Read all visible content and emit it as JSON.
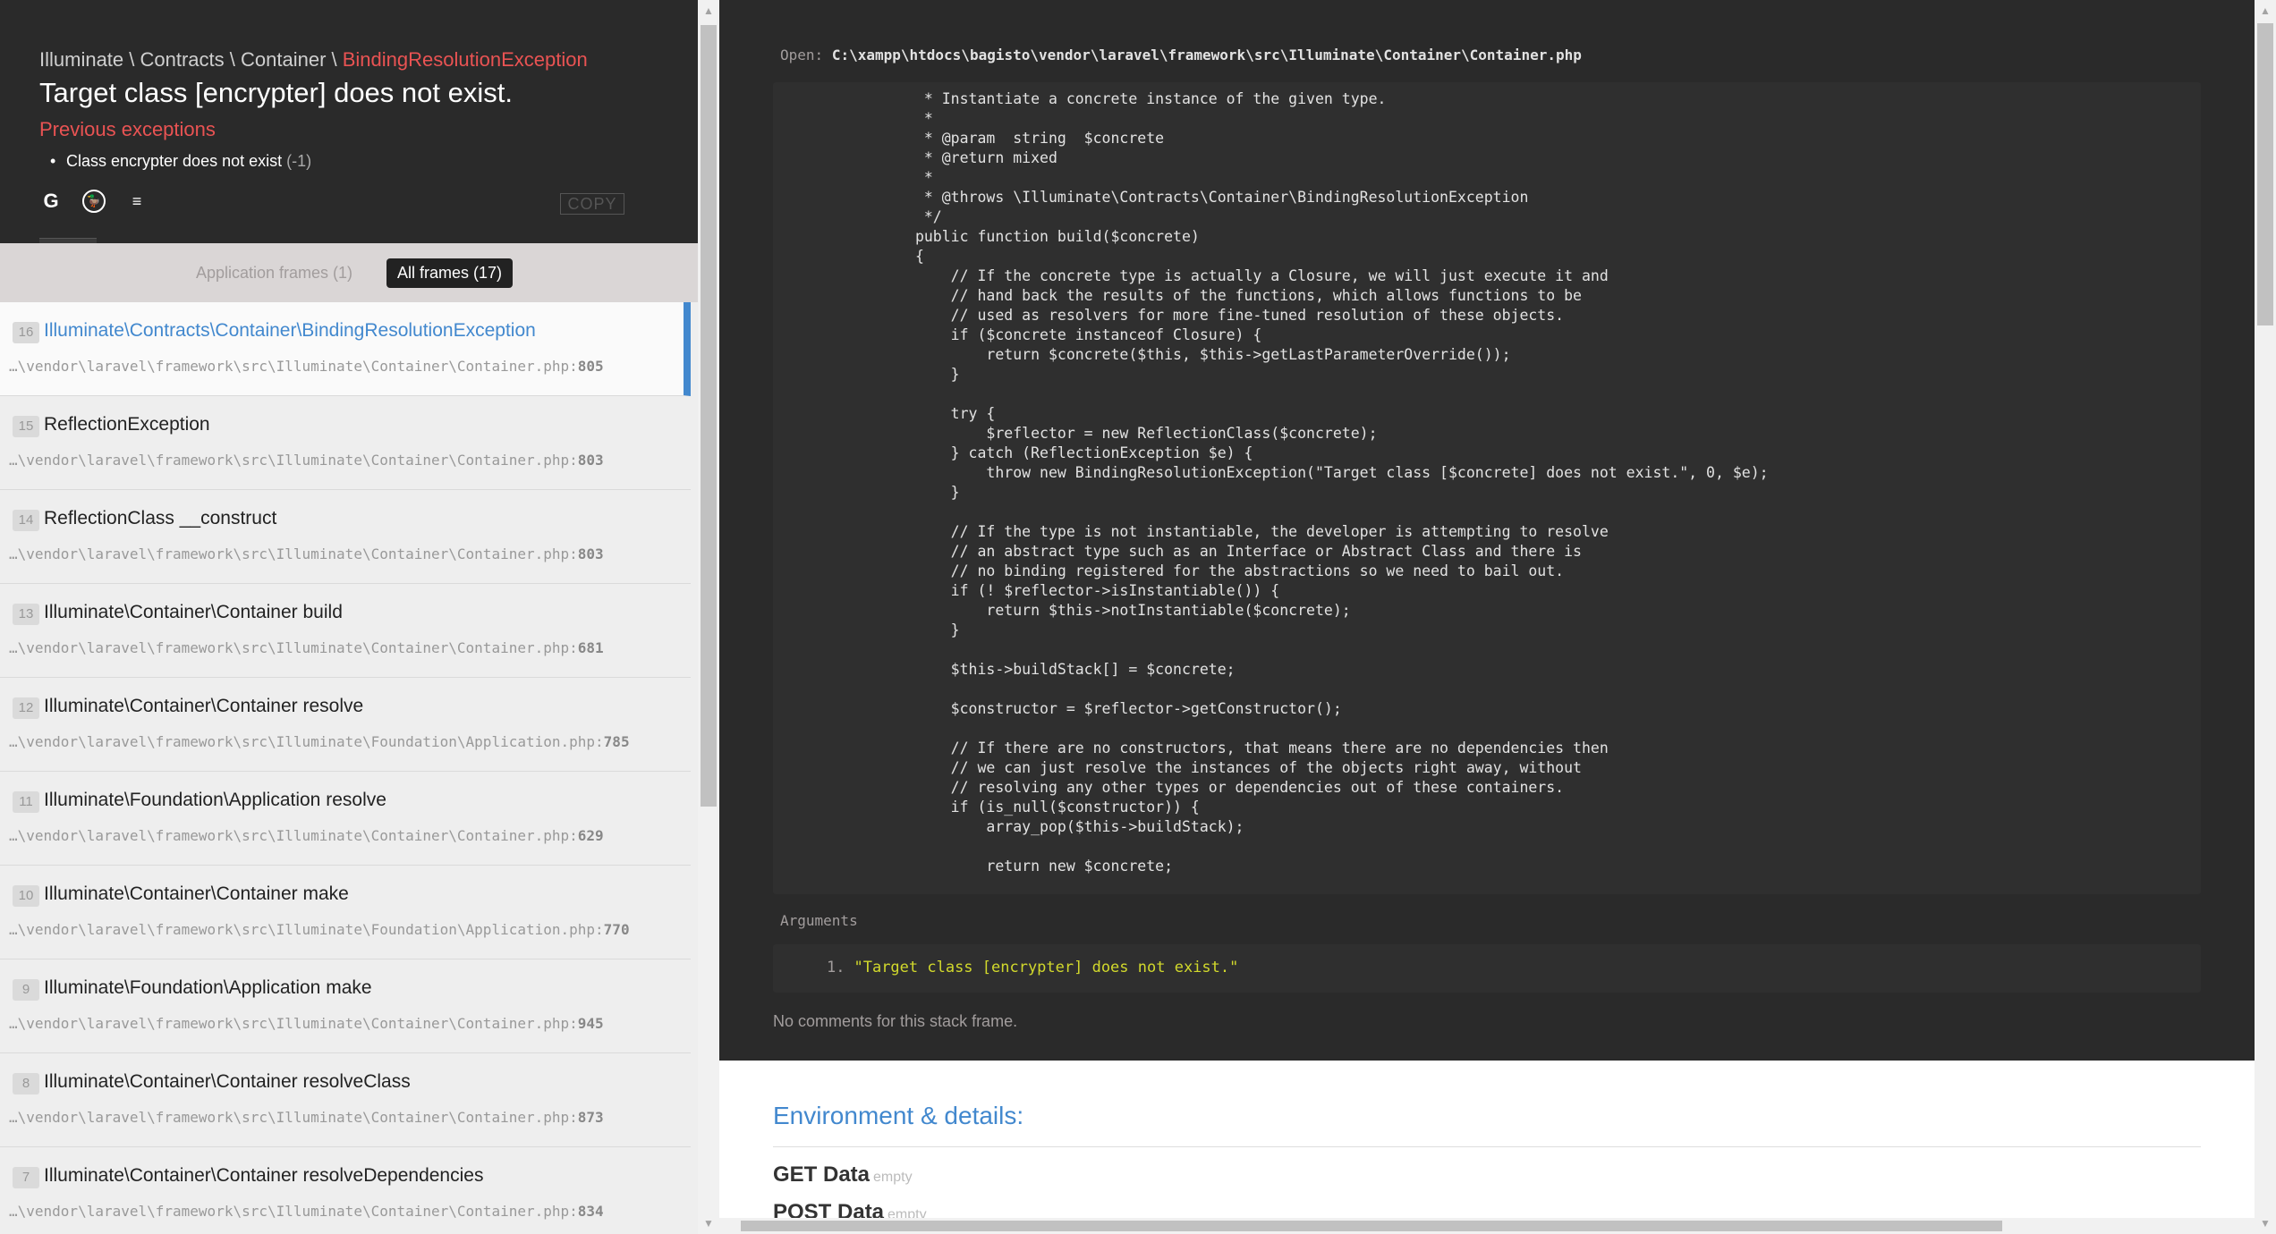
{
  "exception": {
    "namespace_parts": [
      "Illuminate",
      "Contracts",
      "Container"
    ],
    "separator": " \\ ",
    "class_name": "BindingResolutionException",
    "message": "Target class [encrypter] does not exist.",
    "previous_title": "Previous exceptions",
    "previous": [
      {
        "text": "Class encrypter does not exist",
        "code": "(-1)"
      }
    ],
    "search_links": [
      {
        "name": "google-icon",
        "glyph": "G"
      },
      {
        "name": "duckduckgo-icon",
        "glyph": "🦆"
      },
      {
        "name": "stackoverflow-icon",
        "glyph": "≡"
      }
    ],
    "copy_label": "COPY"
  },
  "frames_tabs": {
    "application": "Application frames (1)",
    "all": "All frames (17)"
  },
  "frames": [
    {
      "index": "16",
      "class": "Illuminate\\Contracts\\Container\\BindingResolutionException",
      "method": "",
      "file": "…\\vendor\\laravel\\framework\\src\\Illuminate\\Container\\Container.php",
      "line": "805",
      "active": true
    },
    {
      "index": "15",
      "class": "ReflectionException",
      "method": "",
      "file": "…\\vendor\\laravel\\framework\\src\\Illuminate\\Container\\Container.php",
      "line": "803",
      "active": false
    },
    {
      "index": "14",
      "class": "ReflectionClass",
      "method": "__construct",
      "file": "…\\vendor\\laravel\\framework\\src\\Illuminate\\Container\\Container.php",
      "line": "803",
      "active": false
    },
    {
      "index": "13",
      "class": "Illuminate\\Container\\Container",
      "method": "build",
      "file": "…\\vendor\\laravel\\framework\\src\\Illuminate\\Container\\Container.php",
      "line": "681",
      "active": false
    },
    {
      "index": "12",
      "class": "Illuminate\\Container\\Container",
      "method": "resolve",
      "file": "…\\vendor\\laravel\\framework\\src\\Illuminate\\Foundation\\Application.php",
      "line": "785",
      "active": false
    },
    {
      "index": "11",
      "class": "Illuminate\\Foundation\\Application",
      "method": "resolve",
      "file": "…\\vendor\\laravel\\framework\\src\\Illuminate\\Container\\Container.php",
      "line": "629",
      "active": false
    },
    {
      "index": "10",
      "class": "Illuminate\\Container\\Container",
      "method": "make",
      "file": "…\\vendor\\laravel\\framework\\src\\Illuminate\\Foundation\\Application.php",
      "line": "770",
      "active": false
    },
    {
      "index": "9",
      "class": "Illuminate\\Foundation\\Application",
      "method": "make",
      "file": "…\\vendor\\laravel\\framework\\src\\Illuminate\\Container\\Container.php",
      "line": "945",
      "active": false
    },
    {
      "index": "8",
      "class": "Illuminate\\Container\\Container",
      "method": "resolveClass",
      "file": "…\\vendor\\laravel\\framework\\src\\Illuminate\\Container\\Container.php",
      "line": "873",
      "active": false
    },
    {
      "index": "7",
      "class": "Illuminate\\Container\\Container",
      "method": "resolveDependencies",
      "file": "…\\vendor\\laravel\\framework\\src\\Illuminate\\Container\\Container.php",
      "line": "834",
      "active": false
    }
  ],
  "code_view": {
    "open_label": "Open:",
    "open_path": "C:\\xampp\\htdocs\\bagisto\\vendor\\laravel\\framework\\src\\Illuminate\\Container\\Container.php",
    "lines": [
      "                 * Instantiate a concrete instance of the given type.",
      "                 *",
      "                 * @param  string  $concrete",
      "                 * @return mixed",
      "                 *",
      "                 * @throws \\Illuminate\\Contracts\\Container\\BindingResolutionException",
      "                 */",
      "                public function build($concrete)",
      "                {",
      "                    // If the concrete type is actually a Closure, we will just execute it and",
      "                    // hand back the results of the functions, which allows functions to be",
      "                    // used as resolvers for more fine-tuned resolution of these objects.",
      "                    if ($concrete instanceof Closure) {",
      "                        return $concrete($this, $this->getLastParameterOverride());",
      "                    }",
      "",
      "                    try {",
      "                        $reflector = new ReflectionClass($concrete);",
      "                    } catch (ReflectionException $e) {",
      "                        throw new BindingResolutionException(\"Target class [$concrete] does not exist.\", 0, $e);",
      "                    }",
      "",
      "                    // If the type is not instantiable, the developer is attempting to resolve",
      "                    // an abstract type such as an Interface or Abstract Class and there is",
      "                    // no binding registered for the abstractions so we need to bail out.",
      "                    if (! $reflector->isInstantiable()) {",
      "                        return $this->notInstantiable($concrete);",
      "                    }",
      "",
      "                    $this->buildStack[] = $concrete;",
      "",
      "                    $constructor = $reflector->getConstructor();",
      "",
      "                    // If there are no constructors, that means there are no dependencies then",
      "                    // we can just resolve the instances of the objects right away, without",
      "                    // resolving any other types or dependencies out of these containers.",
      "                    if (is_null($constructor)) {",
      "                        array_pop($this->buildStack);",
      "",
      "                        return new $concrete;"
    ],
    "arguments_title": "Arguments",
    "arguments": [
      {
        "num": "1.",
        "value": "\"Target class [encrypter] does not exist.\""
      }
    ],
    "no_comments": "No comments for this stack frame."
  },
  "environment": {
    "title": "Environment & details:",
    "sections": [
      {
        "label": "GET Data",
        "status": "empty"
      },
      {
        "label": "POST Data",
        "status": "empty"
      }
    ]
  },
  "colors": {
    "accent": "#4288ce",
    "error": "#e95353",
    "string": "#d2d92c",
    "dark_bg": "#2a2a2a"
  }
}
